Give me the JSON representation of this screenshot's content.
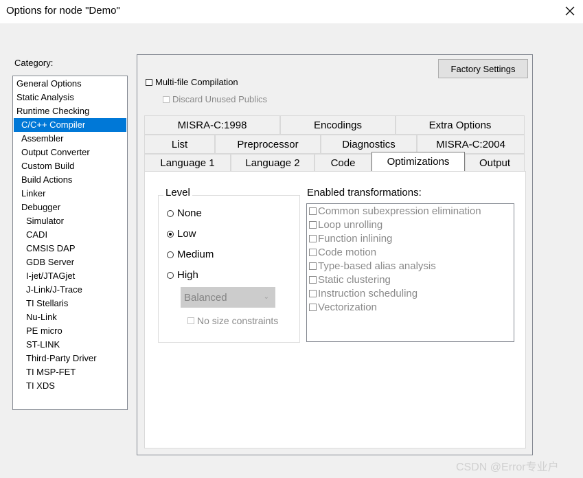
{
  "window": {
    "title": "Options for node \"Demo\""
  },
  "category": {
    "label": "Category:",
    "items": [
      "General Options",
      "Static Analysis",
      "Runtime Checking",
      "C/C++ Compiler",
      "Assembler",
      "Output Converter",
      "Custom Build",
      "Build Actions",
      "Linker",
      "Debugger",
      "Simulator",
      "CADI",
      "CMSIS DAP",
      "GDB Server",
      "I-jet/JTAGjet",
      "J-Link/J-Trace",
      "TI Stellaris",
      "Nu-Link",
      "PE micro",
      "ST-LINK",
      "Third-Party Driver",
      "TI MSP-FET",
      "TI XDS"
    ],
    "selected": "C/C++ Compiler"
  },
  "factory_settings": "Factory Settings",
  "multi_file": "Multi-file Compilation",
  "discard_unused": "Discard Unused Publics",
  "tabs": {
    "row1": [
      "MISRA-C:1998",
      "Encodings",
      "Extra Options"
    ],
    "row2": [
      "List",
      "Preprocessor",
      "Diagnostics",
      "MISRA-C:2004"
    ],
    "row3": [
      "Language 1",
      "Language 2",
      "Code",
      "Optimizations",
      "Output"
    ],
    "active": "Optimizations"
  },
  "level": {
    "label": "Level",
    "options": [
      "None",
      "Low",
      "Medium",
      "High"
    ],
    "selected": "Low",
    "balance": "Balanced",
    "no_size": "No size constraints"
  },
  "transformations": {
    "label": "Enabled transformations:",
    "items": [
      "Common subexpression elimination",
      "Loop unrolling",
      "Function inlining",
      "Code motion",
      "Type-based alias analysis",
      "Static clustering",
      "Instruction scheduling",
      "Vectorization"
    ]
  },
  "watermark": "CSDN @Error专业户"
}
